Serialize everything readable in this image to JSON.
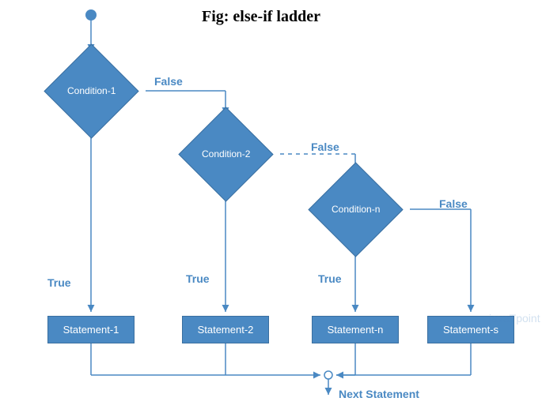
{
  "title": "Fig: else-if ladder",
  "conditions": {
    "c1": "Condition-1",
    "c2": "Condition-2",
    "c3": "Condition-n"
  },
  "statements": {
    "s1": "Statement-1",
    "s2": "Statement-2",
    "s3": "Statement-n",
    "s4": "Statement-s"
  },
  "labels": {
    "trueLabel": "True",
    "falseLabel": "False",
    "next": "Next Statement"
  },
  "watermark": "javaTpoint",
  "colors": {
    "primary": "#4a89c3",
    "text": "#4a89c3"
  }
}
